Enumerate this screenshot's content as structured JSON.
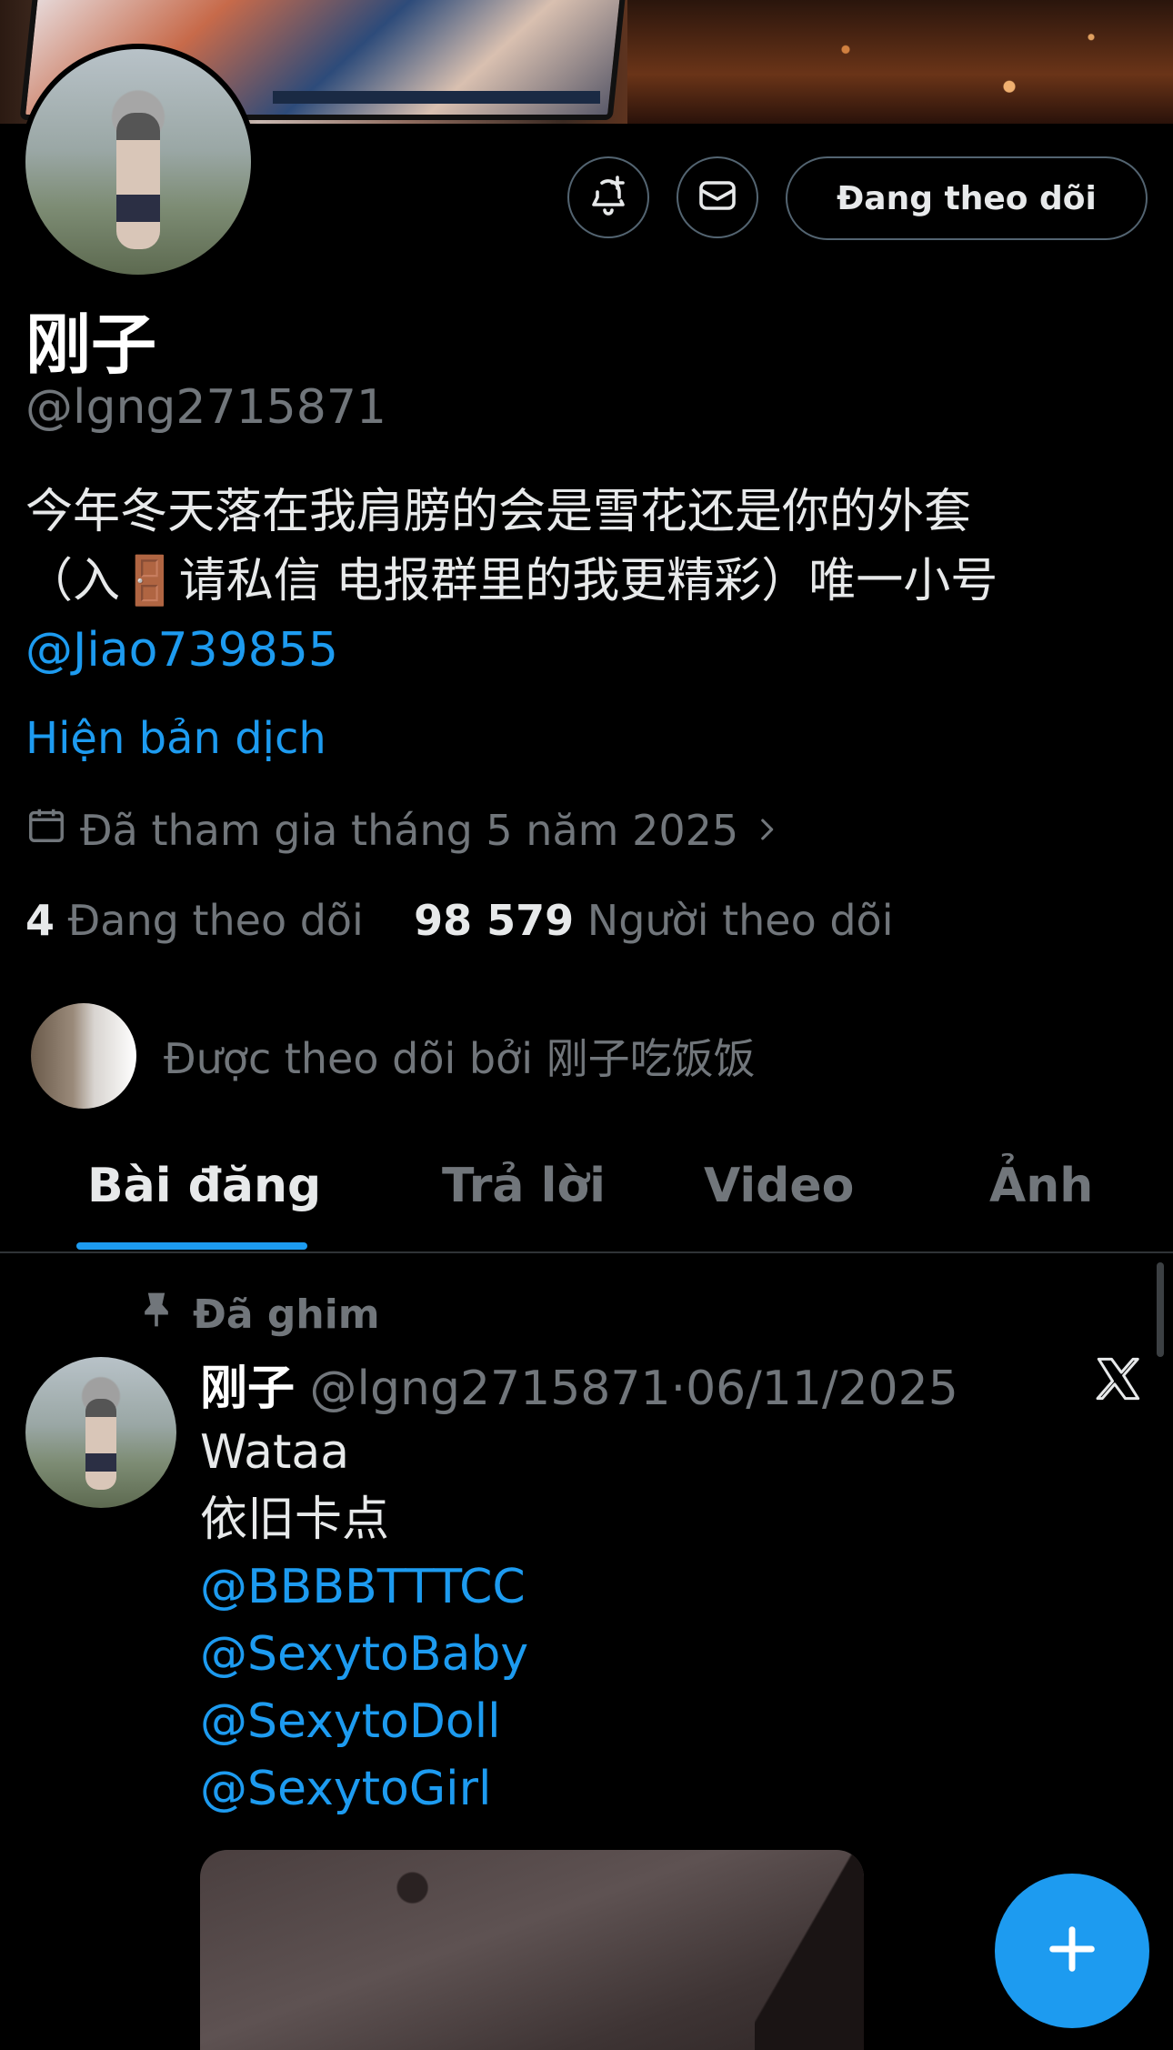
{
  "profile": {
    "display_name": "刚子",
    "handle": "@lgng2715871",
    "bio_line1": "今年冬天落在我肩膀的会是雪花还是你的外套",
    "bio_line2": "（入🚪请私信 电报群里的我更精彩）唯一小号",
    "bio_mention": "@Jiao739855",
    "translate_label": "Hiện bản dịch",
    "joined": "Đã tham gia tháng 5 năm 2025",
    "following_count": "4",
    "following_label": "Đang theo dõi",
    "followers_count": "98 579",
    "followers_label": "Người theo dõi",
    "followed_by": "Được theo dõi bởi 刚子吃饭饭"
  },
  "actions": {
    "follow_label": "Đang theo dõi",
    "notify_icon": "bell-plus-icon",
    "message_icon": "mail-icon"
  },
  "tabs": [
    {
      "label": "Bài đăng",
      "active": true
    },
    {
      "label": "Trả lời",
      "active": false
    },
    {
      "label": "Video",
      "active": false
    },
    {
      "label": "Ảnh",
      "active": false
    }
  ],
  "tweet": {
    "pinned_label": "Đã ghim",
    "author_name": "刚子",
    "author_handle": "@lgng2715871",
    "separator": "·",
    "date": "06/11/2025",
    "text_line1": "Wataa",
    "text_line2": "依旧卡点",
    "mentions": [
      "@BBBBTTTCC",
      "@SexytoBaby",
      "@SexytoDoll",
      "@SexytoGirl"
    ]
  },
  "colors": {
    "accent": "#1d9bf0",
    "background": "#000000",
    "muted": "#71767b"
  }
}
